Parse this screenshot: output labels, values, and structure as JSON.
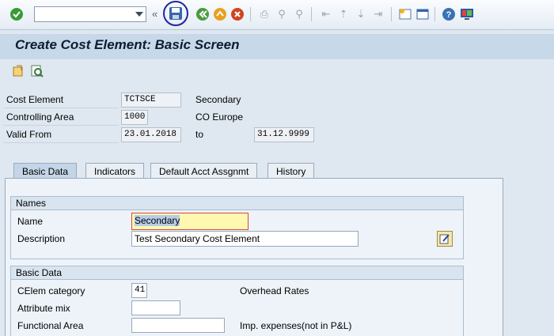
{
  "toolbar": {
    "command_field_value": "",
    "icons": [
      "check-icon",
      "save-icon",
      "back-icon",
      "exit-icon",
      "cancel-icon",
      "print-icon",
      "find-icon",
      "find-next-icon",
      "first-page-icon",
      "prev-page-icon",
      "next-page-icon",
      "last-page-icon",
      "new-session-icon",
      "shortcut-icon",
      "help-icon",
      "customize-icon"
    ],
    "double_arrow": "«"
  },
  "title": "Create Cost Element: Basic Screen",
  "header": {
    "cost_element_label": "Cost Element",
    "cost_element_value": "TCTSCE",
    "cost_element_type": "Secondary",
    "controlling_area_label": "Controlling Area",
    "controlling_area_value": "1000",
    "controlling_area_text": "CO Europe",
    "valid_from_label": "Valid From",
    "valid_from_value": "23.01.2018",
    "to_label": "to",
    "valid_to_value": "31.12.9999"
  },
  "tabs": [
    {
      "label": "Basic Data",
      "active": true
    },
    {
      "label": "Indicators",
      "active": false
    },
    {
      "label": "Default Acct Assgnmt",
      "active": false
    },
    {
      "label": "History",
      "active": false
    }
  ],
  "names_group": {
    "title": "Names",
    "name_label": "Name",
    "name_value": "Secondary",
    "description_label": "Description",
    "description_value": "Test Secondary Cost Element"
  },
  "basic_group": {
    "title": "Basic Data",
    "celem_category_label": "CElem category",
    "celem_category_value": "41",
    "celem_category_text": "Overhead Rates",
    "attribute_mix_label": "Attribute mix",
    "attribute_mix_value": "",
    "functional_area_label": "Functional Area",
    "functional_area_value": "",
    "functional_area_text": "Imp. expenses(not in P&L)"
  },
  "colors": {
    "accent_blue": "#2222aa",
    "title_bg": "#c7d8e8",
    "highlight_yellow": "#fff8b0"
  }
}
